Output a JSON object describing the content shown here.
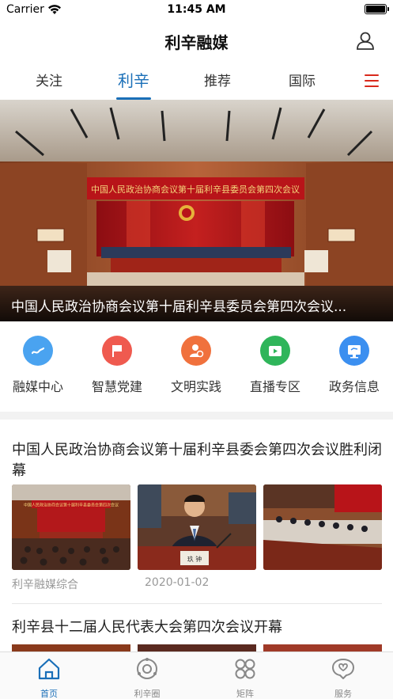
{
  "status_bar": {
    "carrier": "Carrier",
    "time": "11:45 AM"
  },
  "header": {
    "title": "利辛融媒"
  },
  "tabs": [
    {
      "label": "关注",
      "active": false
    },
    {
      "label": "利辛",
      "active": true
    },
    {
      "label": "推荐",
      "active": false
    },
    {
      "label": "国际",
      "active": false
    }
  ],
  "banner": {
    "stage_banner": "中国人民政治协商会议第十届利辛县委员会第四次会议",
    "caption": "中国人民政治协商会议第十届利辛县委员会第四次会议..."
  },
  "quick_entries": [
    {
      "label": "融媒中心",
      "icon": "link-icon",
      "color": "#4aa3f0"
    },
    {
      "label": "智慧党建",
      "icon": "party-flag-icon",
      "color": "#ef5a4f"
    },
    {
      "label": "文明实践",
      "icon": "volunteer-icon",
      "color": "#f0713d"
    },
    {
      "label": "直播专区",
      "icon": "live-play-icon",
      "color": "#2fb55a"
    },
    {
      "label": "政务信息",
      "icon": "government-screen-icon",
      "color": "#3b8ff0"
    }
  ],
  "news": [
    {
      "title": "中国人民政治协商会议第十届利辛县委会第四次会议胜利闭幕",
      "source": "利辛融媒综合",
      "date": "2020-01-02",
      "thumb_banner": "中国人民政治协商会议第十届利辛县委员会第四次会议",
      "speaker_nameplate": "玖 钟"
    },
    {
      "title": "利辛县十二届人民代表大会第四次会议开幕"
    }
  ],
  "bottom_nav": [
    {
      "label": "首页",
      "icon": "home-icon",
      "active": true
    },
    {
      "label": "利辛圈",
      "icon": "circle-icon",
      "active": false
    },
    {
      "label": "矩阵",
      "icon": "matrix-icon",
      "active": false
    },
    {
      "label": "服务",
      "icon": "service-icon",
      "active": false
    }
  ],
  "colors": {
    "accent": "#1a6fb8",
    "menu": "#d9291c",
    "stage_red": "#a8141a"
  }
}
